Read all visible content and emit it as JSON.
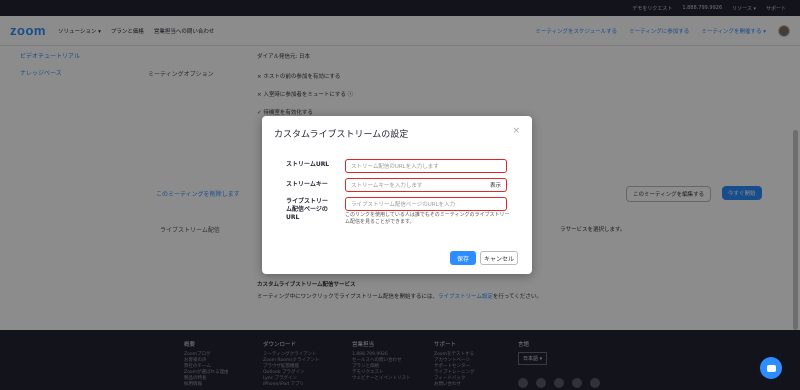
{
  "topbar": {
    "items": [
      "デモをリクエスト",
      "1.888.799.9926",
      "リソース ▾",
      "サポート"
    ]
  },
  "nav": {
    "logo": "zoom",
    "links": [
      "ソリューション ▾",
      "プランと価格",
      "営業担当への問い合わせ"
    ],
    "right_links": [
      "ミーティングをスケジュールする",
      "ミーティングに参加する",
      "ミーティングを開催する ▾"
    ]
  },
  "sidebar": {
    "items": [
      "ビデオチュートリアル",
      "ナレッジベース"
    ]
  },
  "main": {
    "time_zone": "ダイアル発信元: 日本",
    "meeting_options_label": "ミーティングオプション",
    "options": [
      "ホストの前の参加を有効にする",
      "入室時に参加者をミュートにする ⓘ",
      "待機室を有効化する"
    ],
    "delete_link": "このミーティングを削除します",
    "edit_button": "このミーティングを編集する",
    "start_button": "今すぐ開始",
    "livestream_label": "ライブストリーム配信",
    "livestream_service_hint": "ラサービスを選択します。",
    "custom_service_title": "カスタムライブストリーム配信サービス",
    "custom_service_desc": "ミーティング中にワンクリックでライブストリーム配信を開始するには、",
    "custom_service_link": "ライブストリーム設定",
    "custom_service_tail": "を行ってください。"
  },
  "footer": {
    "columns": [
      {
        "heading": "概要",
        "items": [
          "Zoomブログ",
          "お客様の声",
          "弊社のチーム",
          "Zoomが選ばれる理由",
          "製品の特長",
          "採用情報"
        ]
      },
      {
        "heading": "ダウンロード",
        "items": [
          "ミーティングクライアント",
          "Zoom Roomsクライアント",
          "ブラウザ拡張機能",
          "Outlook プラグイン",
          "Lync プラグイン",
          "iPhone/iPad アプリ"
        ]
      },
      {
        "heading": "営業担当",
        "items": [
          "1.888.799.9926",
          "セールスへの問い合わせ",
          "プランと価格",
          "デモリクエスト",
          "ウェビナーとイベントリスト"
        ]
      },
      {
        "heading": "サポート",
        "items": [
          "Zoomをテストする",
          "アカウントページ",
          "サポートセンター",
          "ライブトレーニング",
          "フィードバック",
          "お問い合わせ"
        ]
      }
    ],
    "language_heading": "言語",
    "language_value": "日本語 ▾"
  },
  "modal": {
    "title": "カスタムライブストリームの設定",
    "close": "×",
    "fields": [
      {
        "label": "ストリームURL",
        "placeholder": "ストリーム配信のURLを入力します"
      },
      {
        "label": "ストリームキー",
        "placeholder": "ストリームキーを入力します",
        "show_label": "表示"
      },
      {
        "label": "ライブストリー ム配信ページの URL",
        "placeholder": "ライブストリーム配信ページのURLを入力"
      }
    ],
    "help_text": "このリンクを使用している人は誰でもそのミーティングのライブストリーム配信を見ることができます。",
    "save_label": "保存",
    "cancel_label": "キャンセル"
  },
  "colors": {
    "accent": "#2d8cff",
    "error_border": "#e02828",
    "footer_bg": "#232333"
  }
}
